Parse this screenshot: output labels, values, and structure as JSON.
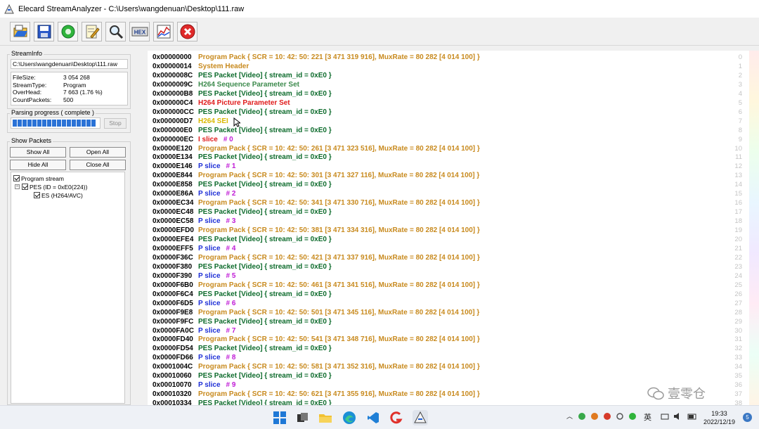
{
  "window": {
    "title": "Elecard StreamAnalyzer - C:\\Users\\wangdenuan\\Desktop\\111.raw"
  },
  "toolbar": [
    "open-icon",
    "save-icon",
    "refresh-icon",
    "edit-icon",
    "search-icon",
    "hex-icon",
    "chart-icon",
    "close-icon"
  ],
  "toolbar_hex_label": "HEX",
  "streaminfo": {
    "label": "StreamInfo",
    "path": "C:\\Users\\wangdenuan\\Desktop\\111.raw",
    "rows": [
      {
        "k": "FileSize:",
        "v": "3 054 268"
      },
      {
        "k": "StreamType:",
        "v": "Program"
      },
      {
        "k": "OverHead:",
        "v": "7 663 (1.76 %)"
      },
      {
        "k": "CountPackets:",
        "v": "500"
      }
    ]
  },
  "parsing": {
    "label": "Parsing progress ( complete )",
    "progress": 1.0,
    "stop_label": "Stop"
  },
  "show_packets": {
    "label": "Show Packets",
    "show_all": "Show All",
    "open_all": "Open All",
    "hide_all": "Hide All",
    "close_all": "Close All",
    "tree": [
      {
        "label": "Program stream",
        "level": 0,
        "checked": true
      },
      {
        "label": "PES (ID = 0xE0(224))",
        "level": 1,
        "checked": true
      },
      {
        "label": "ES (H264/AVC)",
        "level": 2,
        "checked": true
      }
    ]
  },
  "colors": {
    "pack": "#c88a1e",
    "pes": "#0d6b2c",
    "seq": "#3c8a4c",
    "pic": "#e01b1b",
    "sei": "#d9b800",
    "islice": "#e01b1b",
    "pslice": "#1e2fd6",
    "num": "#c01bd6",
    "sys": "#c88a1e"
  },
  "packets": [
    {
      "off": "0x00000000",
      "type": "pack",
      "text": "Program Pack { SCR = 10: 42: 50: 221 [3 471 319 916], MuxRate = 80 282 [4 014 100] }",
      "idx": "0"
    },
    {
      "off": "0x00000014",
      "type": "sys",
      "text": "System Header",
      "idx": "1"
    },
    {
      "off": "0x0000008C",
      "type": "pes",
      "text": "PES Packet [Video] { stream_id = 0xE0 }",
      "idx": "2"
    },
    {
      "off": "0x0000009C",
      "type": "seq",
      "text": "H264 Sequence Parameter Set",
      "idx": "3"
    },
    {
      "off": "0x000000B8",
      "type": "pes",
      "text": "PES Packet [Video] { stream_id = 0xE0 }",
      "idx": "4"
    },
    {
      "off": "0x000000C4",
      "type": "pic",
      "text": "H264 Picture Parameter Set",
      "idx": "5"
    },
    {
      "off": "0x000000CC",
      "type": "pes",
      "text": "PES Packet [Video] { stream_id = 0xE0 }",
      "idx": "6"
    },
    {
      "off": "0x000000D7",
      "type": "sei",
      "text": "H264 SEI",
      "idx": "7"
    },
    {
      "off": "0x000000E0",
      "type": "pes",
      "text": "PES Packet [Video] { stream_id = 0xE0 }",
      "idx": "8"
    },
    {
      "off": "0x000000EC",
      "type": "islice",
      "text": "I  slice",
      "num": "# 0",
      "idx": "9"
    },
    {
      "off": "0x0000E120",
      "type": "pack",
      "text": "Program Pack { SCR = 10: 42: 50: 261 [3 471 323 516], MuxRate = 80 282 [4 014 100] }",
      "idx": "10"
    },
    {
      "off": "0x0000E134",
      "type": "pes",
      "text": "PES Packet [Video] { stream_id = 0xE0 }",
      "idx": "11"
    },
    {
      "off": "0x0000E146",
      "type": "pslice",
      "text": "P slice",
      "num": "# 1",
      "idx": "12"
    },
    {
      "off": "0x0000E844",
      "type": "pack",
      "text": "Program Pack { SCR = 10: 42: 50: 301 [3 471 327 116], MuxRate = 80 282 [4 014 100] }",
      "idx": "13"
    },
    {
      "off": "0x0000E858",
      "type": "pes",
      "text": "PES Packet [Video] { stream_id = 0xE0 }",
      "idx": "14"
    },
    {
      "off": "0x0000E86A",
      "type": "pslice",
      "text": "P slice",
      "num": "# 2",
      "idx": "15"
    },
    {
      "off": "0x0000EC34",
      "type": "pack",
      "text": "Program Pack { SCR = 10: 42: 50: 341 [3 471 330 716], MuxRate = 80 282 [4 014 100] }",
      "idx": "16"
    },
    {
      "off": "0x0000EC48",
      "type": "pes",
      "text": "PES Packet [Video] { stream_id = 0xE0 }",
      "idx": "17"
    },
    {
      "off": "0x0000EC58",
      "type": "pslice",
      "text": "P slice",
      "num": "# 3",
      "idx": "18"
    },
    {
      "off": "0x0000EFD0",
      "type": "pack",
      "text": "Program Pack { SCR = 10: 42: 50: 381 [3 471 334 316], MuxRate = 80 282 [4 014 100] }",
      "idx": "19"
    },
    {
      "off": "0x0000EFE4",
      "type": "pes",
      "text": "PES Packet [Video] { stream_id = 0xE0 }",
      "idx": "20"
    },
    {
      "off": "0x0000EFF5",
      "type": "pslice",
      "text": "P slice",
      "num": "# 4",
      "idx": "21"
    },
    {
      "off": "0x0000F36C",
      "type": "pack",
      "text": "Program Pack { SCR = 10: 42: 50: 421 [3 471 337 916], MuxRate = 80 282 [4 014 100] }",
      "idx": "22"
    },
    {
      "off": "0x0000F380",
      "type": "pes",
      "text": "PES Packet [Video] { stream_id = 0xE0 }",
      "idx": "23"
    },
    {
      "off": "0x0000F390",
      "type": "pslice",
      "text": "P slice",
      "num": "# 5",
      "idx": "24"
    },
    {
      "off": "0x0000F6B0",
      "type": "pack",
      "text": "Program Pack { SCR = 10: 42: 50: 461 [3 471 341 516], MuxRate = 80 282 [4 014 100] }",
      "idx": "25"
    },
    {
      "off": "0x0000F6C4",
      "type": "pes",
      "text": "PES Packet [Video] { stream_id = 0xE0 }",
      "idx": "26"
    },
    {
      "off": "0x0000F6D5",
      "type": "pslice",
      "text": "P slice",
      "num": "# 6",
      "idx": "27"
    },
    {
      "off": "0x0000F9E8",
      "type": "pack",
      "text": "Program Pack { SCR = 10: 42: 50: 501 [3 471 345 116], MuxRate = 80 282 [4 014 100] }",
      "idx": "28"
    },
    {
      "off": "0x0000F9FC",
      "type": "pes",
      "text": "PES Packet [Video] { stream_id = 0xE0 }",
      "idx": "29"
    },
    {
      "off": "0x0000FA0C",
      "type": "pslice",
      "text": "P slice",
      "num": "# 7",
      "idx": "30"
    },
    {
      "off": "0x0000FD40",
      "type": "pack",
      "text": "Program Pack { SCR = 10: 42: 50: 541 [3 471 348 716], MuxRate = 80 282 [4 014 100] }",
      "idx": "31"
    },
    {
      "off": "0x0000FD54",
      "type": "pes",
      "text": "PES Packet [Video] { stream_id = 0xE0 }",
      "idx": "32"
    },
    {
      "off": "0x0000FD66",
      "type": "pslice",
      "text": "P slice",
      "num": "# 8",
      "idx": "33"
    },
    {
      "off": "0x0001004C",
      "type": "pack",
      "text": "Program Pack { SCR = 10: 42: 50: 581 [3 471 352 316], MuxRate = 80 282 [4 014 100] }",
      "idx": "34"
    },
    {
      "off": "0x00010060",
      "type": "pes",
      "text": "PES Packet [Video] { stream_id = 0xE0 }",
      "idx": "35"
    },
    {
      "off": "0x00010070",
      "type": "pslice",
      "text": "P slice",
      "num": "# 9",
      "idx": "36"
    },
    {
      "off": "0x00010320",
      "type": "pack",
      "text": "Program Pack { SCR = 10: 42: 50: 621 [3 471 355 916], MuxRate = 80 282 [4 014 100] }",
      "idx": "37"
    },
    {
      "off": "0x00010334",
      "type": "pes",
      "text": "PES Packet [Video] { stream_id = 0xE0 }",
      "idx": "38"
    }
  ],
  "taskbar": {
    "apps": [
      "windows-start-icon",
      "task-view-icon",
      "file-explorer-icon",
      "edge-icon",
      "vscode-icon",
      "app-g-icon",
      "streamanalyzer-icon"
    ],
    "ime": "英",
    "time": "19:33",
    "date": "2022/12/19",
    "notifications": "5"
  },
  "watermark": "壹零仓"
}
